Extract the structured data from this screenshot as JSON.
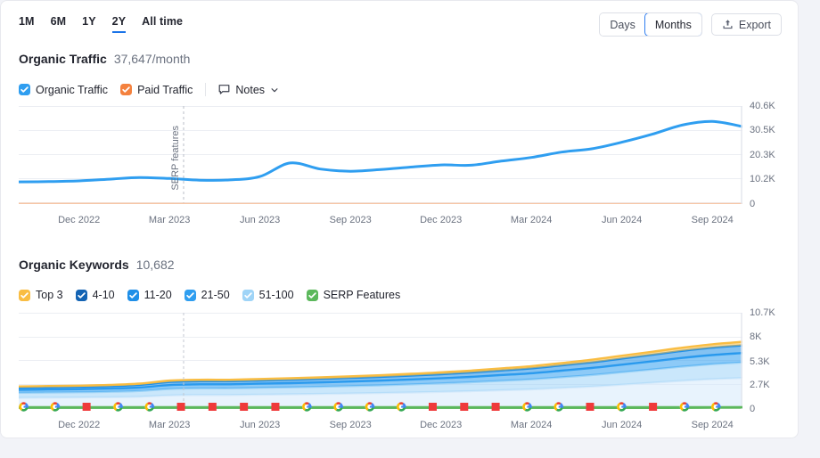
{
  "ranges": [
    {
      "label": "1M",
      "active": false
    },
    {
      "label": "6M",
      "active": false
    },
    {
      "label": "1Y",
      "active": false
    },
    {
      "label": "2Y",
      "active": true
    },
    {
      "label": "All time",
      "active": false
    }
  ],
  "granularity": {
    "options": [
      {
        "label": "Days",
        "selected": false
      },
      {
        "label": "Months",
        "selected": true
      }
    ]
  },
  "export_label": "Export",
  "traffic": {
    "title": "Organic Traffic",
    "value": "37,647/month",
    "legend": [
      {
        "label": "Organic Traffic",
        "color": "#2f9ef0",
        "checked": true
      },
      {
        "label": "Paid Traffic",
        "color": "#f4813e",
        "checked": true
      }
    ],
    "notes_label": "Notes",
    "annotation": "SERP features"
  },
  "keywords": {
    "title": "Organic Keywords",
    "value": "10,682",
    "legend": [
      {
        "label": "Top 3",
        "color": "#f9bd43",
        "checked": true
      },
      {
        "label": "4-10",
        "color": "#1464b4",
        "checked": true
      },
      {
        "label": "11-20",
        "color": "#1f8fe8",
        "checked": true
      },
      {
        "label": "21-50",
        "color": "#2f9ef0",
        "checked": true
      },
      {
        "label": "51-100",
        "color": "#9fd4f7",
        "checked": true
      },
      {
        "label": "SERP Features",
        "color": "#5cb85c",
        "checked": true
      }
    ]
  },
  "chart_data": [
    {
      "type": "line",
      "title": "Organic Traffic",
      "xlabel": "",
      "ylabel": "",
      "ylim": [
        0,
        40600
      ],
      "yticks": [
        0,
        10200,
        20300,
        30500,
        40600
      ],
      "ytick_labels": [
        "0",
        "10.2K",
        "20.3K",
        "30.5K",
        "40.6K"
      ],
      "xticks": [
        "Dec 2022",
        "Mar 2023",
        "Jun 2023",
        "Sep 2023",
        "Dec 2023",
        "Mar 2024",
        "Jun 2024",
        "Sep 2024"
      ],
      "grid": true,
      "legend_position": "top-left",
      "annotations": [
        {
          "text": "SERP features",
          "x": "Mar 2023",
          "style": "dashed-vertical"
        }
      ],
      "series": [
        {
          "name": "Organic Traffic",
          "color": "#2f9ef0",
          "x": [
            "Oct 2022",
            "Nov 2022",
            "Dec 2022",
            "Jan 2023",
            "Feb 2023",
            "Mar 2023",
            "Apr 2023",
            "May 2023",
            "Jun 2023",
            "Jul 2023",
            "Aug 2023",
            "Sep 2023",
            "Oct 2023",
            "Nov 2023",
            "Dec 2023",
            "Jan 2024",
            "Feb 2024",
            "Mar 2024",
            "Apr 2024",
            "May 2024",
            "Jun 2024",
            "Jul 2024",
            "Aug 2024",
            "Sep 2024",
            "Oct 2024"
          ],
          "values": [
            9200,
            9300,
            9600,
            10300,
            11000,
            10600,
            9900,
            10000,
            11400,
            17000,
            14500,
            13600,
            14300,
            15300,
            16200,
            16100,
            17800,
            19300,
            21500,
            22900,
            25600,
            28900,
            32700,
            34200,
            32100
          ]
        },
        {
          "name": "Paid Traffic",
          "color": "#f7c6a6",
          "x": [
            "Oct 2022",
            "Nov 2022",
            "Dec 2022",
            "Jan 2023",
            "Feb 2023",
            "Mar 2023",
            "Apr 2023",
            "May 2023",
            "Jun 2023",
            "Jul 2023",
            "Aug 2023",
            "Sep 2023",
            "Oct 2023",
            "Nov 2023",
            "Dec 2023",
            "Jan 2024",
            "Feb 2024",
            "Mar 2024",
            "Apr 2024",
            "May 2024",
            "Jun 2024",
            "Jul 2024",
            "Aug 2024",
            "Sep 2024",
            "Oct 2024"
          ],
          "values": [
            260,
            250,
            250,
            240,
            240,
            240,
            230,
            230,
            230,
            220,
            220,
            220,
            210,
            210,
            210,
            210,
            200,
            200,
            200,
            200,
            190,
            190,
            190,
            180,
            180
          ]
        }
      ]
    },
    {
      "type": "area",
      "stacked": true,
      "title": "Organic Keywords",
      "xlabel": "",
      "ylabel": "",
      "ylim": [
        0,
        10700
      ],
      "yticks": [
        0,
        2700,
        5300,
        8000,
        10700
      ],
      "ytick_labels": [
        "0",
        "2.7K",
        "5.3K",
        "8K",
        "10.7K"
      ],
      "xticks": [
        "Dec 2022",
        "Mar 2023",
        "Jun 2023",
        "Sep 2023",
        "Dec 2023",
        "Mar 2024",
        "Jun 2024",
        "Sep 2024"
      ],
      "grid": true,
      "legend_position": "top-left",
      "x": [
        "Oct 2022",
        "Nov 2022",
        "Dec 2022",
        "Jan 2023",
        "Feb 2023",
        "Mar 2023",
        "Apr 2023",
        "May 2023",
        "Jun 2023",
        "Jul 2023",
        "Aug 2023",
        "Sep 2023",
        "Oct 2023",
        "Nov 2023",
        "Dec 2023",
        "Jan 2024",
        "Feb 2024",
        "Mar 2024",
        "Apr 2024",
        "May 2024",
        "Jun 2024",
        "Jul 2024",
        "Aug 2024",
        "Sep 2024",
        "Oct 2024"
      ],
      "series": [
        {
          "name": "SERP Features",
          "color": "#5cb85c",
          "values": [
            60,
            60,
            60,
            60,
            60,
            60,
            60,
            60,
            70,
            70,
            70,
            70,
            70,
            70,
            80,
            80,
            80,
            80,
            90,
            90,
            100,
            110,
            130,
            170,
            200
          ]
        },
        {
          "name": "51-100",
          "color": "#d6eafb",
          "values": [
            1180,
            1200,
            1220,
            1250,
            1300,
            1450,
            1500,
            1500,
            1530,
            1560,
            1600,
            1650,
            1700,
            1760,
            1820,
            1900,
            2000,
            2100,
            2250,
            2400,
            2600,
            2800,
            3000,
            3150,
            3250
          ]
        },
        {
          "name": "21-50",
          "color": "#9fd4f7",
          "values": [
            560,
            570,
            580,
            600,
            640,
            720,
            740,
            740,
            760,
            780,
            800,
            830,
            860,
            900,
            940,
            990,
            1050,
            1110,
            1190,
            1280,
            1380,
            1480,
            1580,
            1660,
            1720
          ]
        },
        {
          "name": "11-20",
          "color": "#2f9ef0",
          "values": [
            330,
            335,
            340,
            355,
            380,
            430,
            440,
            440,
            450,
            465,
            480,
            500,
            520,
            545,
            570,
            600,
            640,
            680,
            730,
            785,
            845,
            905,
            965,
            1015,
            1050
          ]
        },
        {
          "name": "4-10",
          "color": "#1f8fe8",
          "values": [
            260,
            265,
            270,
            280,
            300,
            340,
            350,
            350,
            360,
            370,
            385,
            400,
            415,
            435,
            455,
            480,
            510,
            545,
            585,
            630,
            680,
            730,
            780,
            820,
            850
          ]
        },
        {
          "name": "Top 3",
          "color": "#f9bd43",
          "values": [
            120,
            122,
            125,
            130,
            140,
            158,
            162,
            162,
            167,
            172,
            178,
            186,
            193,
            202,
            212,
            223,
            237,
            253,
            272,
            293,
            316,
            340,
            363,
            382,
            396
          ]
        }
      ],
      "event_markers": {
        "description": "Google algorithm update markers along baseline",
        "types": [
          "google-update",
          "serp-change"
        ],
        "sequence": [
          "google-update",
          "google-update",
          "serp-change",
          "google-update",
          "google-update",
          "serp-change",
          "serp-change",
          "serp-change",
          "serp-change",
          "google-update",
          "google-update",
          "google-update",
          "google-update",
          "serp-change",
          "serp-change",
          "serp-change",
          "google-update",
          "google-update",
          "serp-change",
          "google-update",
          "serp-change",
          "google-update",
          "google-update"
        ]
      }
    }
  ]
}
